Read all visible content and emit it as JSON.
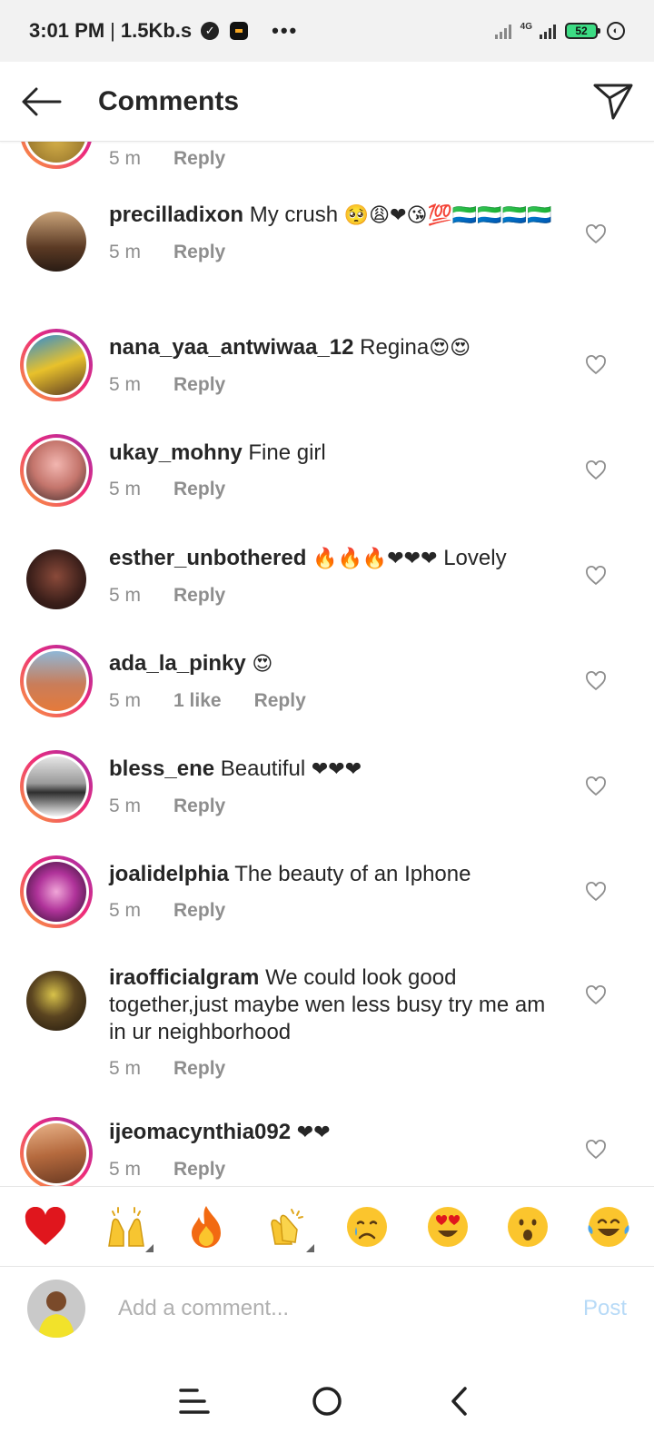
{
  "status_bar": {
    "time": "3:01 PM",
    "separator": "|",
    "speed": "1.5Kb.s",
    "dots": "•••",
    "network_label": "4G",
    "battery": "52"
  },
  "header": {
    "title": "Comments"
  },
  "partial_comment": {
    "time": "5 m",
    "reply": "Reply"
  },
  "comments": [
    {
      "username": "precilladixon",
      "text_before": "My crush",
      "emojis": "🥺😩❤😘💯🇸🇱🇸🇱🇸🇱🇸🇱",
      "time": "5 m",
      "reply": "Reply"
    },
    {
      "username": "nana_yaa_antwiwaa_12",
      "text_before": "Regina",
      "emojis": "😍😍",
      "time": "5 m",
      "reply": "Reply"
    },
    {
      "username": "ukay_mohny",
      "text_before": "Fine girl",
      "emojis": "",
      "time": "5 m",
      "reply": "Reply"
    },
    {
      "username": "esther_unbothered",
      "text_before": "",
      "emojis": "🔥🔥🔥❤❤❤",
      "text_after": "Lovely",
      "time": "5 m",
      "reply": "Reply"
    },
    {
      "username": "ada_la_pinky",
      "text_before": "",
      "emojis": "😍",
      "time": "5 m",
      "likes": "1 like",
      "reply": "Reply"
    },
    {
      "username": "bless_ene",
      "text_before": "Beautiful",
      "emojis": "❤❤❤",
      "time": "5 m",
      "reply": "Reply"
    },
    {
      "username": "joalidelphia",
      "text_before": "The beauty of an Iphone",
      "emojis": "",
      "time": "5 m",
      "reply": "Reply"
    },
    {
      "username": "iraofficialgram",
      "text_before": "We could look good together,just maybe wen less busy try me am in ur neighborhood",
      "emojis": "",
      "time": "5 m",
      "reply": "Reply"
    },
    {
      "username": "ijeomacynthia092",
      "text_before": "",
      "emojis": "❤❤",
      "time": "5 m",
      "reply": "Reply"
    }
  ],
  "reactions": [
    "❤",
    "🙌",
    "🔥",
    "👏",
    "😢",
    "😍",
    "😮",
    "😂"
  ],
  "comment_box": {
    "placeholder": "Add a comment...",
    "post_label": "Post"
  },
  "colors": {
    "ring_gradient_start": "#f9a13a",
    "ring_gradient_end": "#9b2fae",
    "meta_gray": "#8e8e8e",
    "post_disabled": "#b7daf7",
    "heart_red": "#e0161d"
  }
}
